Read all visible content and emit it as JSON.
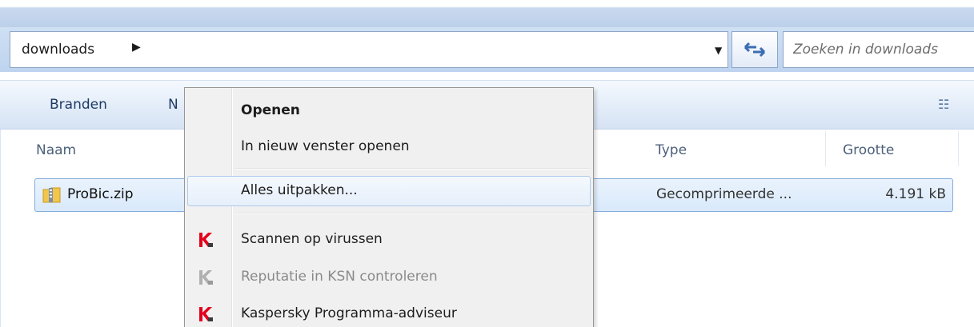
{
  "address_bar": {
    "crumb": "downloads",
    "crumb_arrow": "▶",
    "dropdown_arrow": "▼",
    "refresh_icon": "refresh-arrows-icon",
    "search_placeholder": "Zoeken in downloads"
  },
  "toolbar": {
    "burn_label": "Branden",
    "new_folder_partial": "N",
    "view_icon": "view-options-icon"
  },
  "columns": {
    "name": "Naam",
    "type": "Type",
    "size": "Grootte"
  },
  "file": {
    "name": "ProBic.zip",
    "type": "Gecomprimeerde ...",
    "size": "4.191 kB",
    "icon": "zip-folder-icon"
  },
  "context_menu": {
    "open": "Openen",
    "open_new_window": "In nieuw venster openen",
    "extract_all": "Alles uitpakken...",
    "scan_viruses": "Scannen op virussen",
    "ksn_reputation": "Reputatie in KSN controleren",
    "kaspersky_advisor": "Kaspersky Programma-adviseur",
    "kaspersky_icon": "kaspersky-k-icon",
    "colors": {
      "kaspersky_red": "#e3001b",
      "kaspersky_disabled": "#b0b0b0"
    }
  }
}
